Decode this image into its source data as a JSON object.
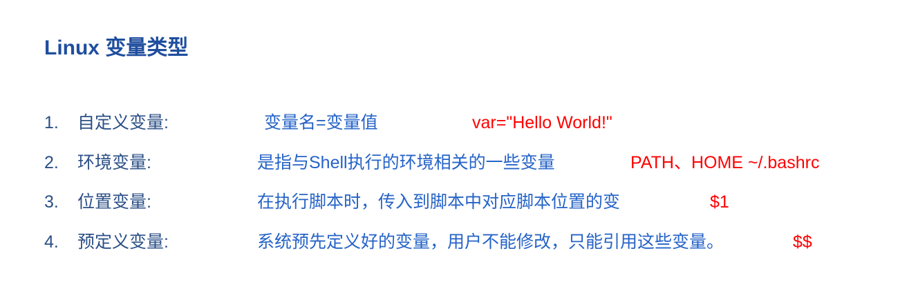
{
  "title": "Linux 变量类型",
  "items": [
    {
      "number": "1.",
      "label": "自定义变量:",
      "description": "变量名=变量值",
      "example": "var=\"Hello World!\""
    },
    {
      "number": "2.",
      "label": "环境变量:",
      "description": "是指与Shell执行的环境相关的一些变量",
      "example": "PATH、HOME  ~/.bashrc"
    },
    {
      "number": "3.",
      "label": "位置变量:",
      "description": "在执行脚本时，传入到脚本中对应脚本位置的变",
      "example": "$1"
    },
    {
      "number": "4.",
      "label": "预定义变量:",
      "description": "系统预先定义好的变量，用户不能修改，只能引用这些变量。",
      "example": "$$"
    }
  ],
  "colors": {
    "title": "#1f4e9e",
    "text": "#2b4f86",
    "description": "#2563c7",
    "example": "#ff0000"
  }
}
